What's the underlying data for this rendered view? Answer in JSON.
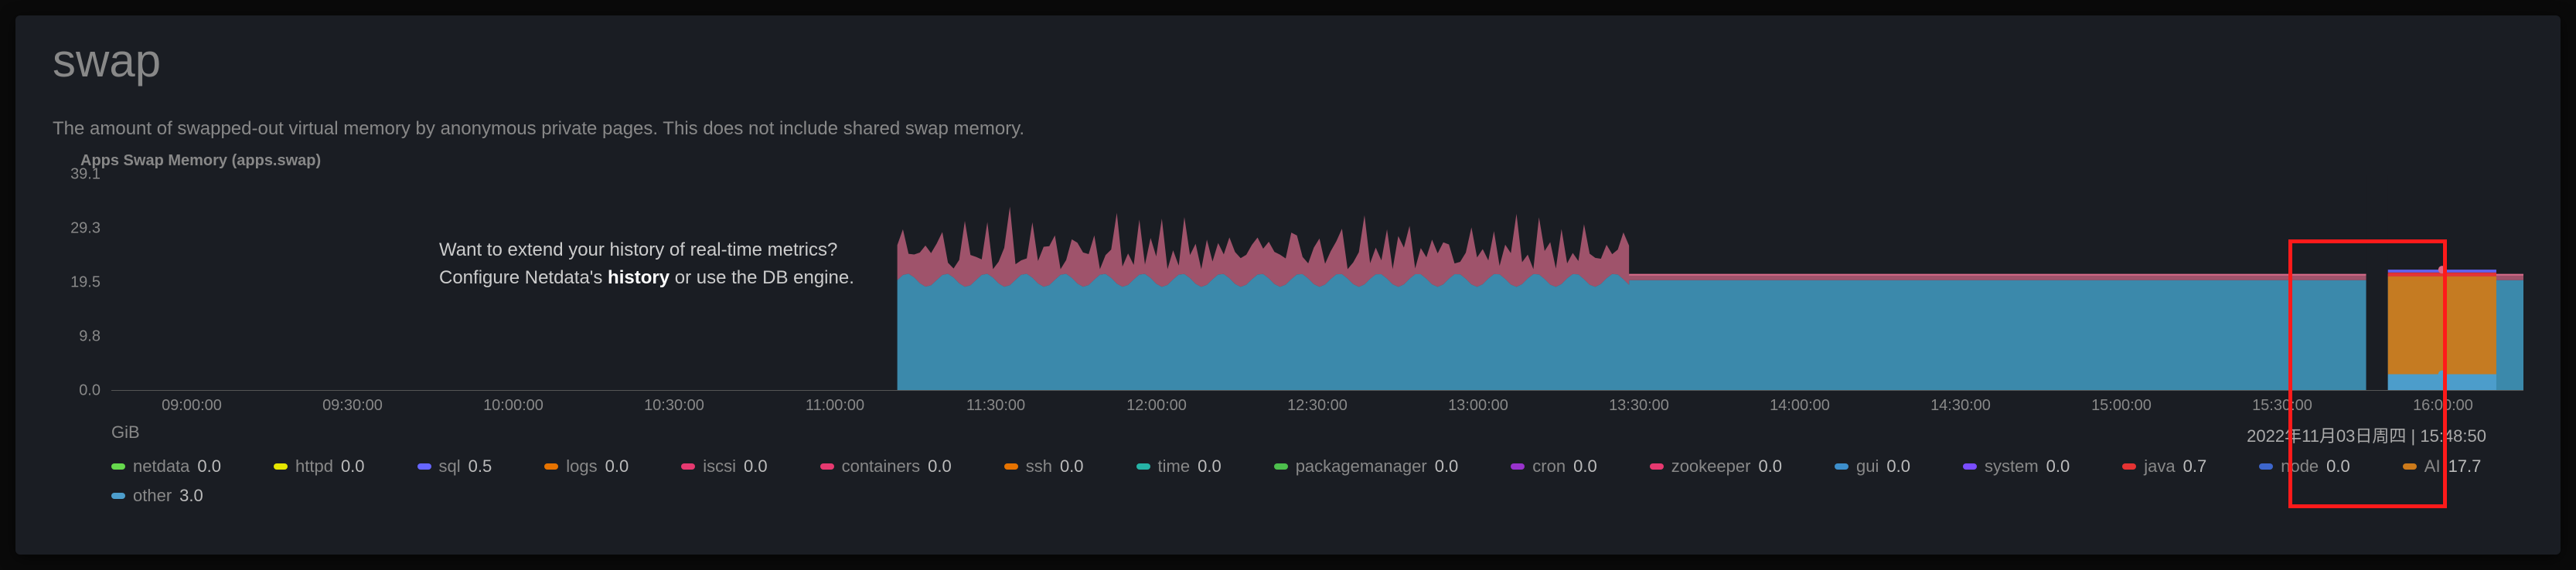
{
  "title": "swap",
  "description": "The amount of swapped-out virtual memory by anonymous private pages. This does not include shared swap memory.",
  "chart_title": "Apps Swap Memory (apps.swap)",
  "unit": "GiB",
  "timestamp": "2022年11月03日周四 | 15:48:50",
  "overlay": {
    "line1": "Want to extend your history of real-time metrics?",
    "line2a": "Configure Netdata's ",
    "line2b": "history",
    "line2c": " or use the DB engine."
  },
  "y_ticks": [
    "39.1",
    "29.3",
    "19.5",
    "9.8",
    "0.0"
  ],
  "x_ticks": [
    "09:00:00",
    "09:30:00",
    "10:00:00",
    "10:30:00",
    "11:00:00",
    "11:30:00",
    "12:00:00",
    "12:30:00",
    "13:00:00",
    "13:30:00",
    "14:00:00",
    "14:30:00",
    "15:00:00",
    "15:30:00",
    "16:00:00"
  ],
  "legend": [
    {
      "name": "netdata",
      "val": "0.0",
      "color": "#66d94d"
    },
    {
      "name": "httpd",
      "val": "0.0",
      "color": "#e6e600"
    },
    {
      "name": "sql",
      "val": "0.5",
      "color": "#6666ff"
    },
    {
      "name": "logs",
      "val": "0.0",
      "color": "#e67300"
    },
    {
      "name": "iscsi",
      "val": "0.0",
      "color": "#e63970"
    },
    {
      "name": "containers",
      "val": "0.0",
      "color": "#e63970"
    },
    {
      "name": "ssh",
      "val": "0.0",
      "color": "#e67300"
    },
    {
      "name": "time",
      "val": "0.0",
      "color": "#26b3a6"
    },
    {
      "name": "packagemanager",
      "val": "0.0",
      "color": "#4dbf4d"
    },
    {
      "name": "cron",
      "val": "0.0",
      "color": "#9933cc"
    },
    {
      "name": "zookeeper",
      "val": "0.0",
      "color": "#e63970"
    },
    {
      "name": "gui",
      "val": "0.0",
      "color": "#3d8fcc"
    },
    {
      "name": "system",
      "val": "0.0",
      "color": "#7a4dff"
    },
    {
      "name": "java",
      "val": "0.7",
      "color": "#e63333"
    },
    {
      "name": "node",
      "val": "0.0",
      "color": "#3d66cc"
    },
    {
      "name": "AI",
      "val": "17.7",
      "color": "#cc7a1a"
    },
    {
      "name": "other",
      "val": "3.0",
      "color": "#4d9ecc"
    }
  ],
  "chart_data": {
    "type": "area",
    "title": "Apps Swap Memory (apps.swap)",
    "ylabel": "GiB",
    "xlabel": "",
    "ylim": [
      0,
      39.1
    ],
    "x_range": [
      "08:45:00",
      "16:10:00"
    ],
    "description": "Stacked area. Data begins ~11:10. Before that all zero. Total stacked value oscillates roughly 22-34 GiB with noisy spikes until ~13:25, then levels to a flat ~21 GiB plateau through 16:00+. Dominant visible layers: 'other' (blue, ~18-20 during noisy period then ~18 flat), thin 'AI' (orange) and miscellaneous on top. Highlighted red box near right edge (~15:45-16:05 region) shows a separate stacked composition: bottom thin blue ~3, large orange 'AI' ~17.7, topped by thin red/blue slivers totaling ~21.",
    "legend_values_at_cursor": {
      "netdata": 0.0,
      "httpd": 0.0,
      "sql": 0.5,
      "logs": 0.0,
      "iscsi": 0.0,
      "containers": 0.0,
      "ssh": 0.0,
      "time": 0.0,
      "packagemanager": 0.0,
      "cron": 0.0,
      "zookeeper": 0.0,
      "gui": 0.0,
      "system": 0.0,
      "java": 0.7,
      "node": 0.0,
      "AI": 17.7,
      "other": 3.0
    },
    "noisy_segment": {
      "start": "11:10",
      "end": "13:25",
      "total_min": 22,
      "total_max": 34,
      "base_blue_approx": 20
    },
    "flat_segment": {
      "start": "13:25",
      "end": "16:10",
      "total": 21,
      "base_blue_approx": 20
    },
    "highlight_box_segment": {
      "start": "15:45",
      "end": "16:05",
      "layers_bottom_to_top": [
        {
          "name": "other",
          "value": 3.0,
          "color": "#4d9ecc"
        },
        {
          "name": "AI",
          "value": 17.7,
          "color": "#cc7a1a"
        },
        {
          "name": "java",
          "value": 0.7,
          "color": "#e63333"
        },
        {
          "name": "sql",
          "value": 0.5,
          "color": "#6666ff"
        }
      ],
      "total": 21.9
    }
  }
}
